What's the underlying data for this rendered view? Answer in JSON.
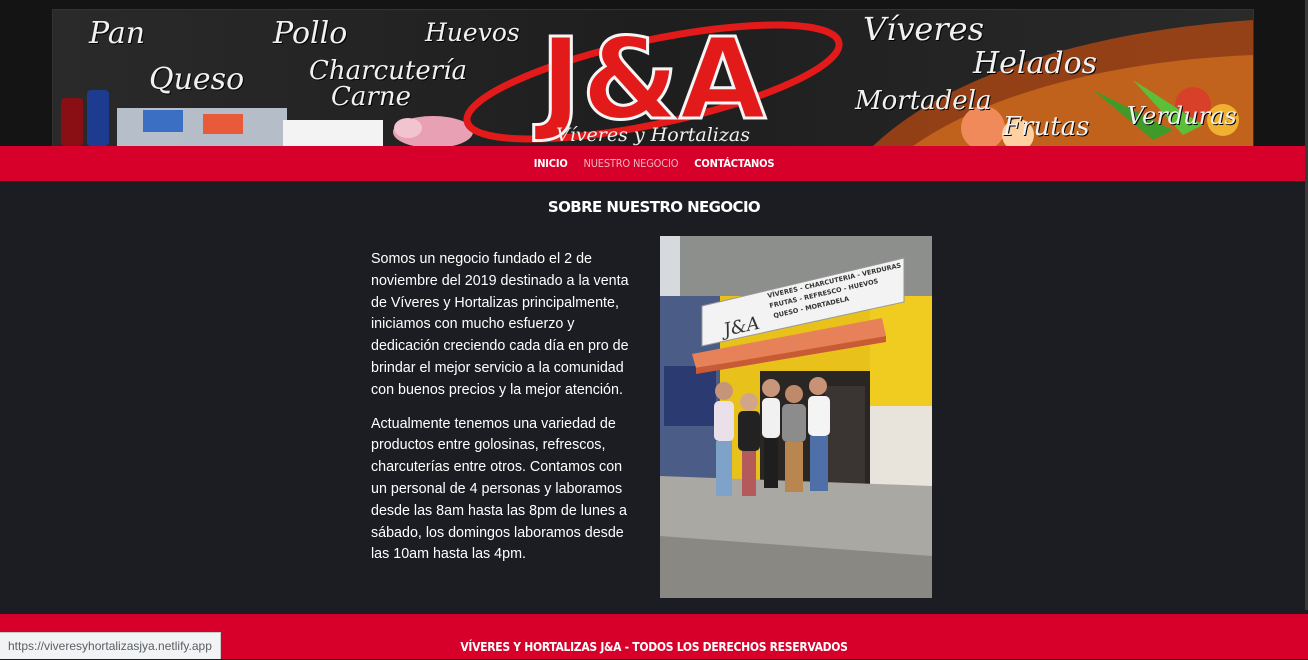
{
  "banner": {
    "words": [
      "Pan",
      "Pollo",
      "Huevos",
      "Víveres",
      "Queso",
      "Charcutería",
      "Carne",
      "Helados",
      "Mortadela",
      "Frutas",
      "Verduras"
    ],
    "logo_text": "J&A",
    "logo_subtitle": "Víveres y Hortalizas"
  },
  "nav": {
    "items": [
      {
        "label": "Inicio",
        "active": false
      },
      {
        "label": "Nuestro Negocio",
        "active": true
      },
      {
        "label": "Contáctanos",
        "active": false
      }
    ]
  },
  "main": {
    "title": "Sobre nuestro negocio",
    "paragraphs": [
      "Somos un negocio fundado el 2 de noviembre del 2019 destinado a la venta de Víveres y Hortalizas principalmente, iniciamos con mucho esfuerzo y dedicación creciendo cada día en pro de brindar el mejor servicio a la comunidad con buenos precios y la mejor atención.",
      "Actualmente tenemos una variedad de productos entre golosinas, refrescos, charcuterías entre otros. Contamos con un personal de 4 personas y laboramos desde las 8am hasta las 8pm de lunes a sábado, los domingos laboramos desde las 10am hasta las 4pm."
    ],
    "photo": {
      "sign_logo": "J&A",
      "sign_lines": [
        "VÍVERES - CHARCUTERIA - VERDURAS",
        "FRUTAS - REFRESCO - HUEVOS",
        "QUESO - MORTADELA"
      ]
    }
  },
  "footer": {
    "text": "Víveres y Hortalizas J&A - Todos los derechos reservados"
  },
  "status_bar": {
    "url": "https://viveresyhortalizasjya.netlify.app"
  },
  "colors": {
    "accent_red": "#d6002a",
    "background": "#1b1d22",
    "nav_active": "#f2b3c1"
  }
}
